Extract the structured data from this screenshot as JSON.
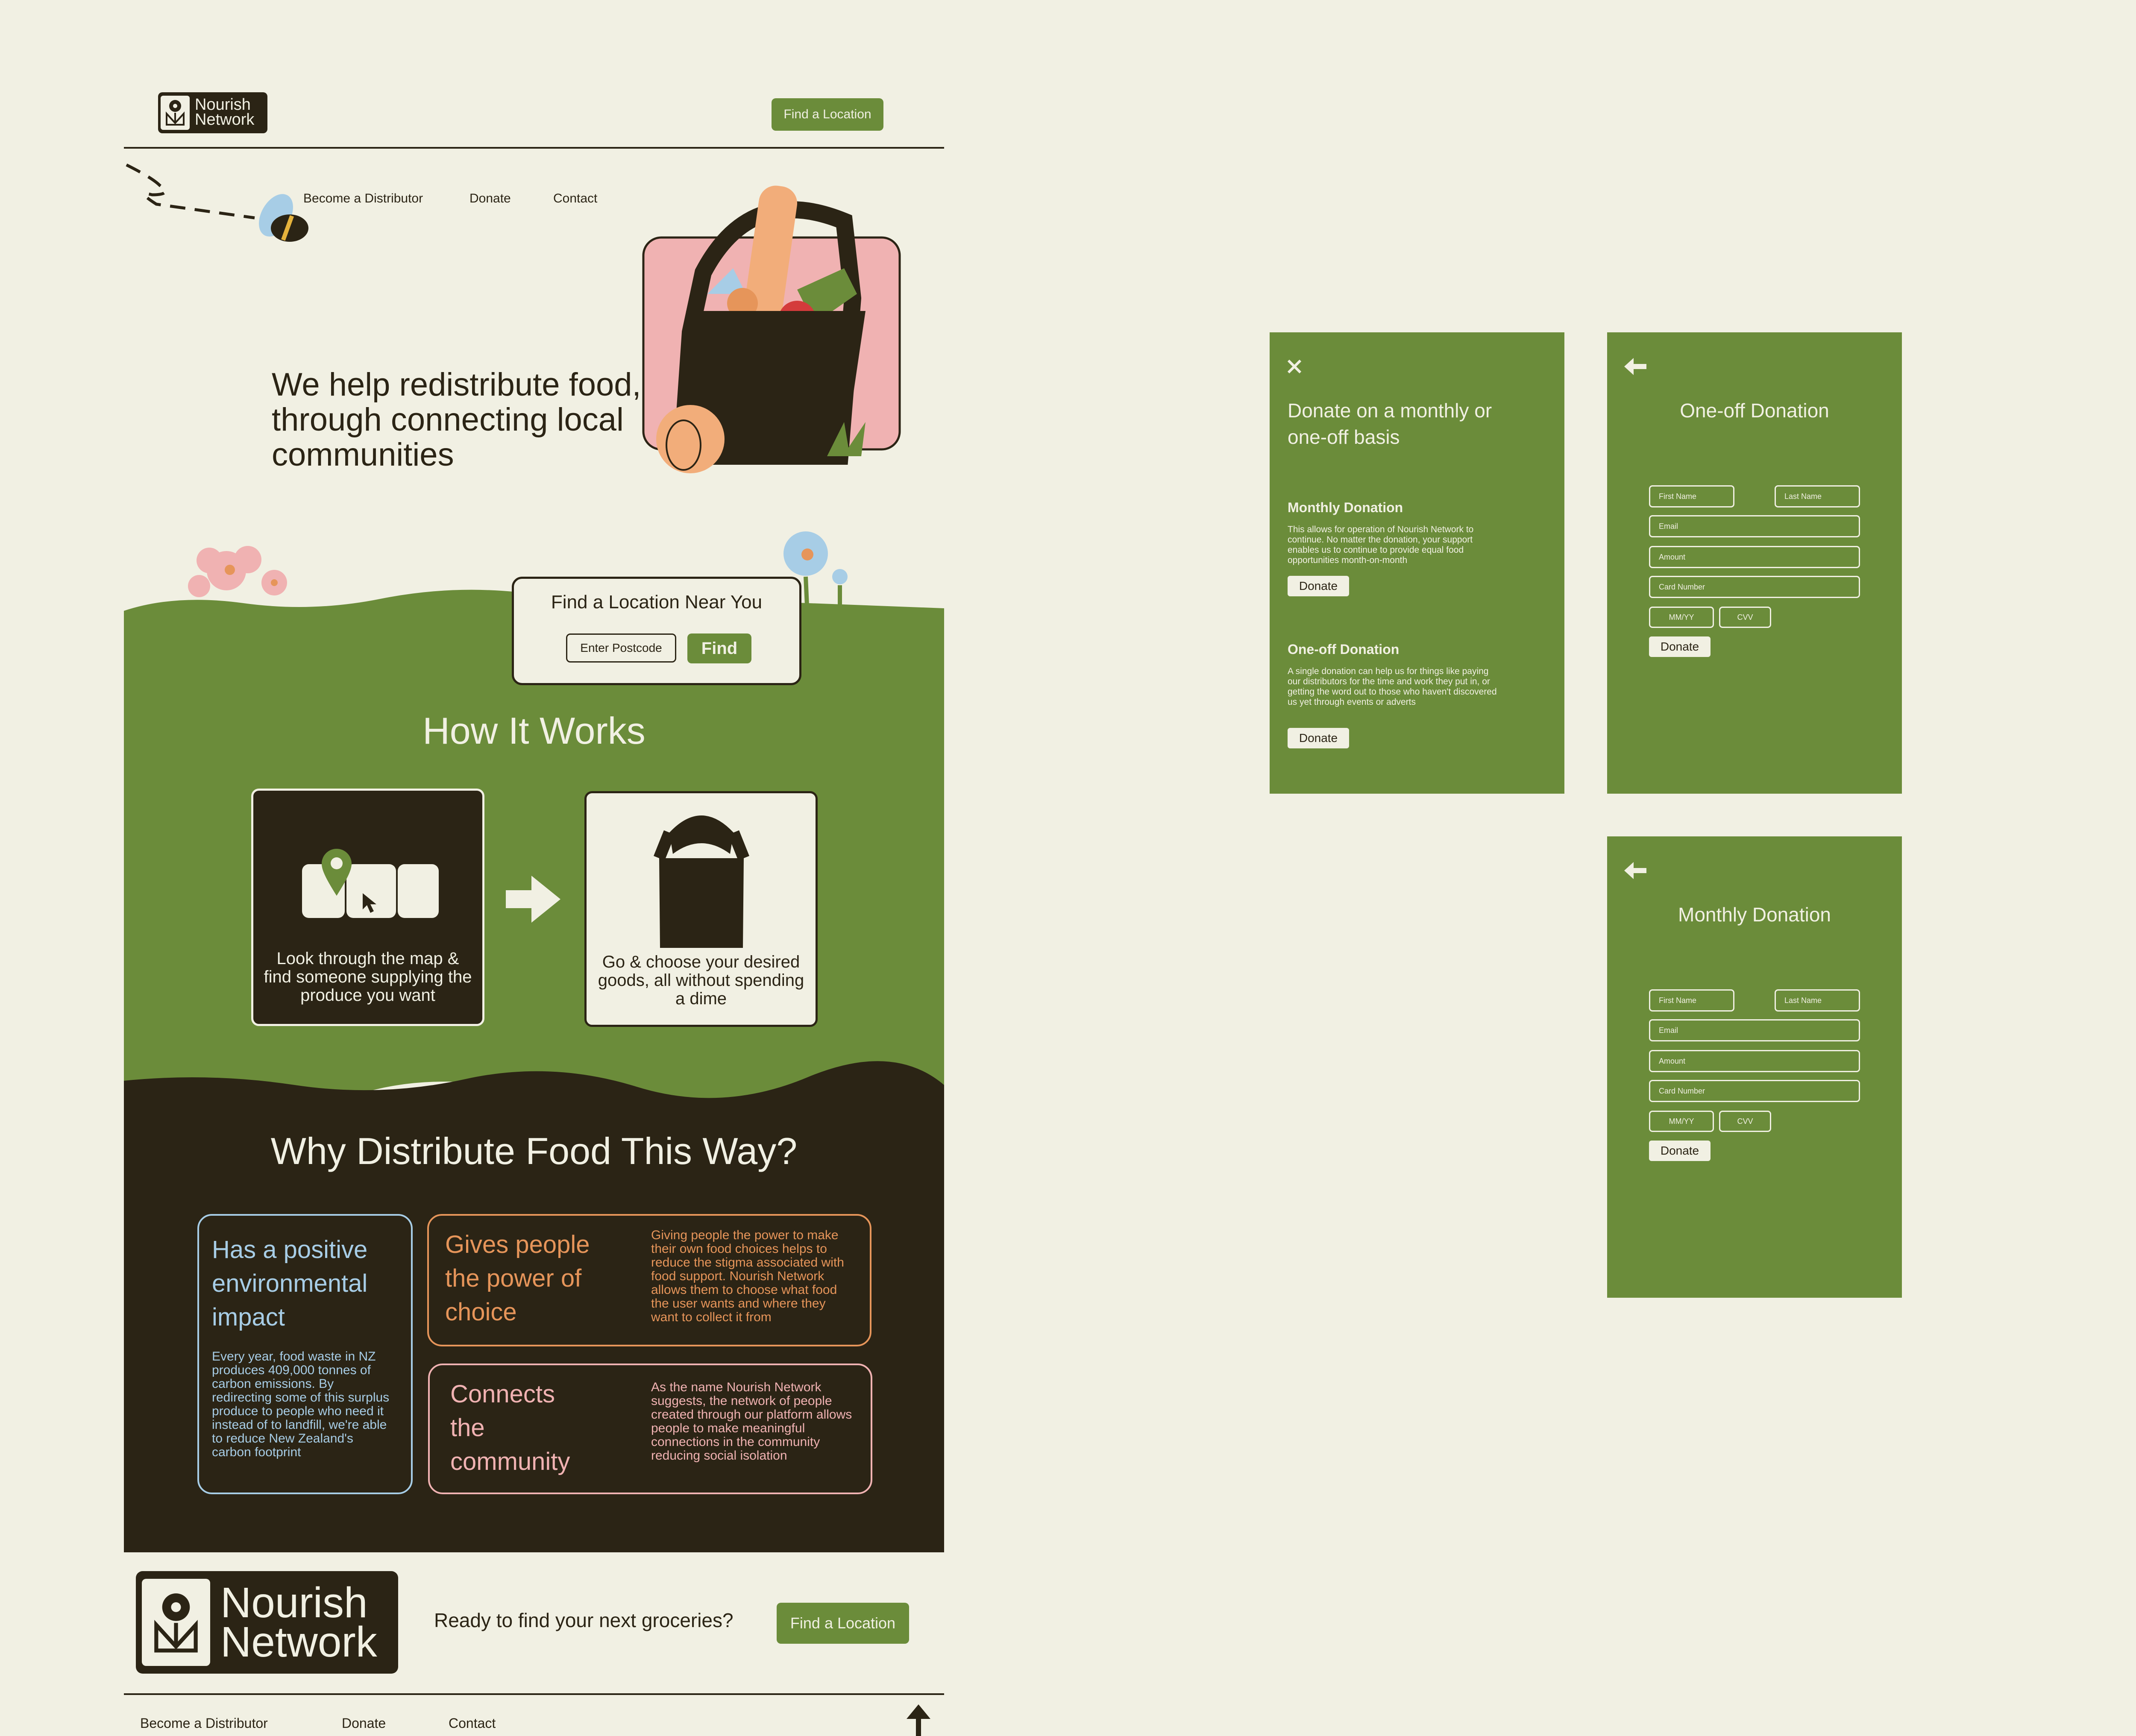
{
  "brand": {
    "name_line1": "Nourish",
    "name_line2": "Network"
  },
  "header": {
    "nav": [
      "Become a Distributor",
      "Donate",
      "Contact"
    ],
    "cta": "Find a Location"
  },
  "hero": {
    "title": "We help redistribute food, through connecting local communities"
  },
  "finder": {
    "title": "Find a Location Near You",
    "postcode_placeholder": "Enter Postcode",
    "find_label": "Find"
  },
  "how_it_works": {
    "title": "How It Works",
    "steps": [
      "Look through the map & find someone supplying the produce you want",
      "Go & choose your desired goods, all without spending a dime"
    ]
  },
  "why": {
    "title": "Why Distribute Food This Way?",
    "cards": [
      {
        "heading": "Has a positive environmental impact",
        "body": "Every year, food waste in NZ produces 409,000 tonnes of carbon emissions. By redirecting some of this surplus produce to people who need it instead of to landfill, we're able to reduce New Zealand's carbon footprint"
      },
      {
        "heading": "Gives people the power of choice",
        "body": "Giving people the power to make their own food choices helps to reduce the stigma associated with food support. Nourish Network allows them to choose what food the user wants and where they want to collect it from"
      },
      {
        "heading": "Connects the community",
        "body": "As the name Nourish Network suggests, the network of people created through our platform allows people to make meaningful connections in the community reducing social isolation"
      }
    ]
  },
  "footer": {
    "question": "Ready to find your next groceries?",
    "cta": "Find a Location",
    "nav": [
      "Become a Distributor",
      "Donate",
      "Contact"
    ]
  },
  "donate_panel": {
    "title": "Donate on a monthly or one-off basis",
    "monthly_heading": "Monthly Donation",
    "monthly_body": "This allows for operation of Nourish Network to continue. No matter the donation, your support enables us to continue to provide equal food opportunities month-on-month",
    "oneoff_heading": "One-off Donation",
    "oneoff_body": "A single donation can help us for things like paying our distributors for the time and work they put in, or getting the word out to those who haven't discovered us yet through events or adverts",
    "button": "Donate"
  },
  "form_labels": {
    "first_name": "First Name",
    "last_name": "Last Name",
    "email": "Email",
    "amount": "Amount",
    "card_number": "Card Number",
    "expiry": "MM/YY",
    "cvv": "CVV",
    "submit": "Donate"
  },
  "oneoff_form": {
    "title": "One-off Donation"
  },
  "monthly_form": {
    "title": "Monthly Donation"
  },
  "icons": [
    "flower-icon",
    "close-icon",
    "back-arrow-icon",
    "arrow-up-icon",
    "location-pin-icon",
    "cursor-icon",
    "arrow-right-icon",
    "bag-icon",
    "bee-icon"
  ],
  "colors": {
    "cream": "#f1f0e3",
    "green": "#6b8c3a",
    "dark": "#2b2415",
    "blue": "#a7cde6",
    "orange": "#e6955a",
    "pink": "#f0b2b2"
  }
}
